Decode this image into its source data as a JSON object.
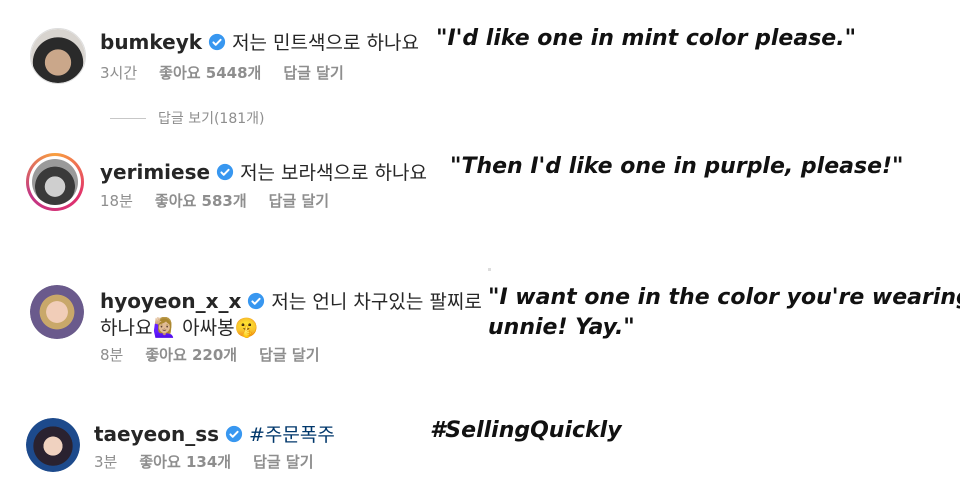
{
  "colors": {
    "verified": "#3897f0",
    "hashtag": "#00376b",
    "meta": "#8e8e8e",
    "story_ring": "#e1306c"
  },
  "comments": [
    {
      "username": "bumkeyk",
      "text": "저는 민트색으로 하나요",
      "time": "3시간",
      "likes": "좋아요 5448개",
      "reply": "답글 달기",
      "translation": "\"I'd like one in mint color please.\""
    },
    {
      "username": "yerimiese",
      "text": "저는 보라색으로 하나요",
      "time": "18분",
      "likes": "좋아요 583개",
      "reply": "답글 달기",
      "translation": "\"Then I'd like one in purple, please!\""
    },
    {
      "username": "hyoyeon_x_x",
      "text_line1": "저는 언니 차구있는 팔찌로",
      "text_line2": "하나요🙋🏼‍♀️ 아싸봉🤫",
      "time": "8분",
      "likes": "좋아요 220개",
      "reply": "답글 달기",
      "translation_line1": "\"I want one in the color you're wearing,",
      "translation_line2": "unnie! Yay.\""
    },
    {
      "username": "taeyeon_ss",
      "text": "#주문폭주",
      "time": "3분",
      "likes": "좋아요 134개",
      "reply": "답글 달기",
      "translation": "#SellingQuickly"
    }
  ],
  "view_replies": "답글 보기(181개)"
}
